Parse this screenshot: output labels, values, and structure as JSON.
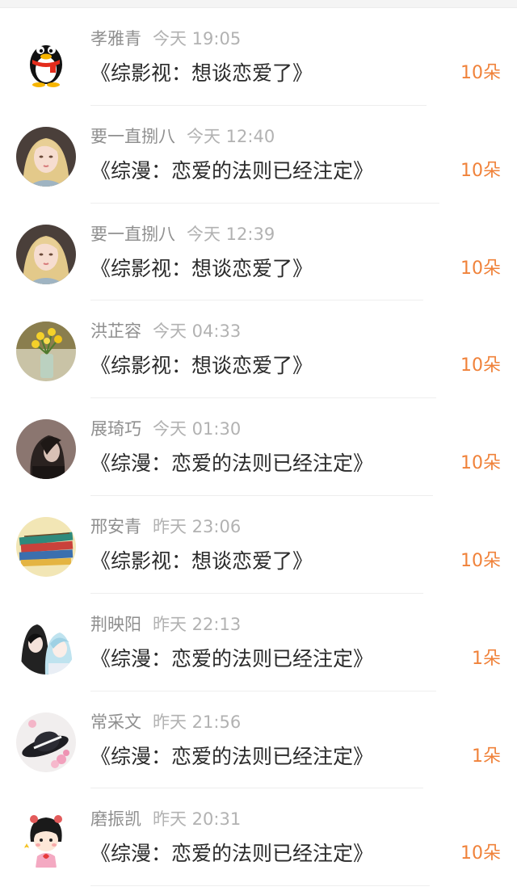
{
  "rows": [
    {
      "user": "孝雅青",
      "time": "今天 19:05",
      "title": "《综影视：想谈恋爱了》",
      "count": "10朵",
      "avatar": "penguin-avatar"
    },
    {
      "user": "要一直捌八",
      "time": "今天 12:40",
      "title": "《综漫：恋爱的法则已经注定》",
      "count": "10朵",
      "avatar": "girl-portrait-avatar"
    },
    {
      "user": "要一直捌八",
      "time": "今天 12:39",
      "title": "《综影视：想谈恋爱了》",
      "count": "10朵",
      "avatar": "girl-portrait-avatar"
    },
    {
      "user": "洪芷容",
      "time": "今天 04:33",
      "title": "《综影视：想谈恋爱了》",
      "count": "10朵",
      "avatar": "flower-vase-avatar"
    },
    {
      "user": "展琦巧",
      "time": "今天 01:30",
      "title": "《综漫：恋爱的法则已经注定》",
      "count": "10朵",
      "avatar": "dark-portrait-avatar"
    },
    {
      "user": "邢安青",
      "time": "昨天 23:06",
      "title": "《综影视：想谈恋爱了》",
      "count": "10朵",
      "avatar": "notebooks-avatar"
    },
    {
      "user": "荆映阳",
      "time": "昨天 22:13",
      "title": "《综漫：恋爱的法则已经注定》",
      "count": "1朵",
      "avatar": "anime-duo-avatar"
    },
    {
      "user": "常采文",
      "time": "昨天 21:56",
      "title": "《综漫：恋爱的法则已经注定》",
      "count": "1朵",
      "avatar": "hat-flowers-avatar"
    },
    {
      "user": "磨振凯",
      "time": "昨天 20:31",
      "title": "《综漫：恋爱的法则已经注定》",
      "count": "10朵",
      "avatar": "cartoon-girl-avatar"
    }
  ],
  "colors": {
    "accent": "#f0823a",
    "name": "#8f8f8f",
    "time": "#b2b2b2",
    "title": "#2a2a2a"
  }
}
